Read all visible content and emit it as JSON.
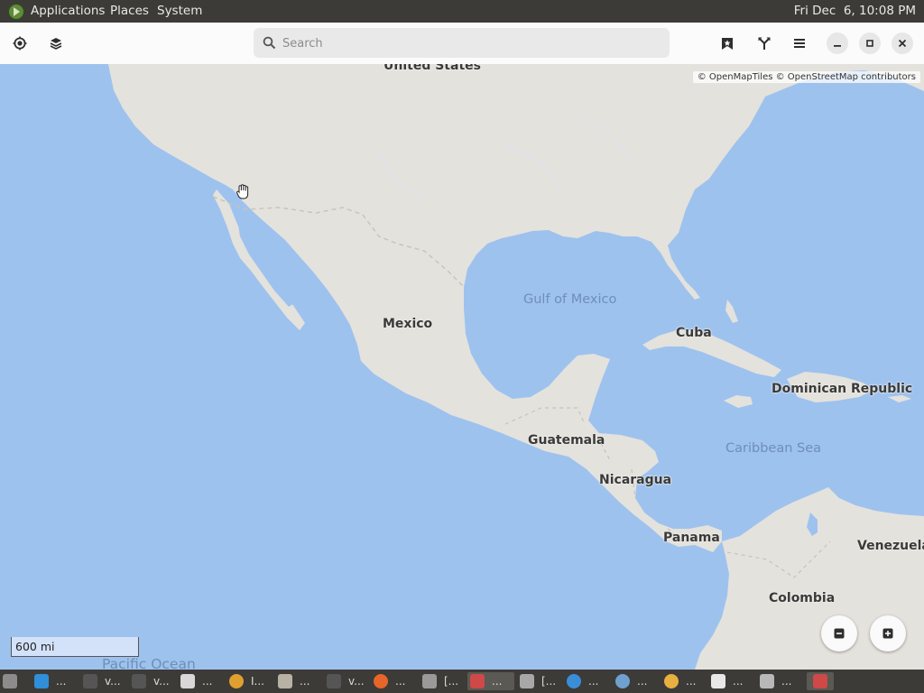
{
  "top_panel": {
    "menus": [
      "Applications",
      "Places",
      "System"
    ],
    "clock": "Fri Dec  6, 10:08 PM"
  },
  "header": {
    "left_icons": [
      "location-icon",
      "layers-icon"
    ],
    "search": {
      "placeholder": "Search",
      "value": ""
    },
    "right_icons": [
      "favorites-icon",
      "route-icon",
      "menu-icon",
      "minimize-icon",
      "maximize-icon",
      "close-icon"
    ]
  },
  "map": {
    "attribution": "© OpenMapTiles © OpenStreetMap contributors",
    "scale": "600 mi",
    "labels": {
      "united_states": "United States",
      "mexico": "Mexico",
      "gulf_of_mexico": "Gulf of Mexico",
      "cuba": "Cuba",
      "dominican_republic": "Dominican Republic",
      "caribbean_sea": "Caribbean Sea",
      "guatemala": "Guatemala",
      "nicaragua": "Nicaragua",
      "panama": "Panama",
      "venezuela": "Venezuela",
      "colombia": "Colombia",
      "pacific_ocean": "Pacific Ocean"
    },
    "zoom_out_icon": "zoom-out-icon",
    "zoom_in_icon": "zoom-in-icon",
    "colors": {
      "water": "#9ec2ee",
      "land": "#e4e2dd",
      "border": "#c9c3b6"
    }
  },
  "taskbar": {
    "items": [
      {
        "label": "",
        "icon": "show-desktop-icon",
        "color": "#8c8c8c"
      },
      {
        "label": "...",
        "icon": "vscode-icon",
        "color": "#2f8fd8"
      },
      {
        "label": "v...",
        "icon": "terminal-icon",
        "color": "#555555"
      },
      {
        "label": "v...",
        "icon": "terminal-icon",
        "color": "#555555"
      },
      {
        "label": "...",
        "icon": "window-icon",
        "color": "#d8d8d8"
      },
      {
        "label": "I...",
        "icon": "app-icon",
        "color": "#e0a030"
      },
      {
        "label": "...",
        "icon": "folder-icon",
        "color": "#b8b2a4"
      },
      {
        "label": "v...",
        "icon": "terminal-icon",
        "color": "#555555"
      },
      {
        "label": "...",
        "icon": "firefox-icon",
        "color": "#e8652a"
      },
      {
        "label": "[...",
        "icon": "camera-icon",
        "color": "#9a9a9a"
      },
      {
        "label": "...",
        "icon": "maps-icon",
        "color": "#d04848"
      },
      {
        "label": "[...",
        "icon": "screenshot-icon",
        "color": "#a8a8a8"
      },
      {
        "label": "...",
        "icon": "globe-icon",
        "color": "#3a8ed8"
      },
      {
        "label": "...",
        "icon": "settings-icon",
        "color": "#6fa0d0"
      },
      {
        "label": "...",
        "icon": "weather-icon",
        "color": "#e8b040"
      },
      {
        "label": "...",
        "icon": "home-icon",
        "color": "#e8e8e8"
      },
      {
        "label": "...",
        "icon": "disk-icon",
        "color": "#b8b8b8"
      },
      {
        "label": "",
        "icon": "maps-icon",
        "color": "#d04848"
      }
    ]
  }
}
